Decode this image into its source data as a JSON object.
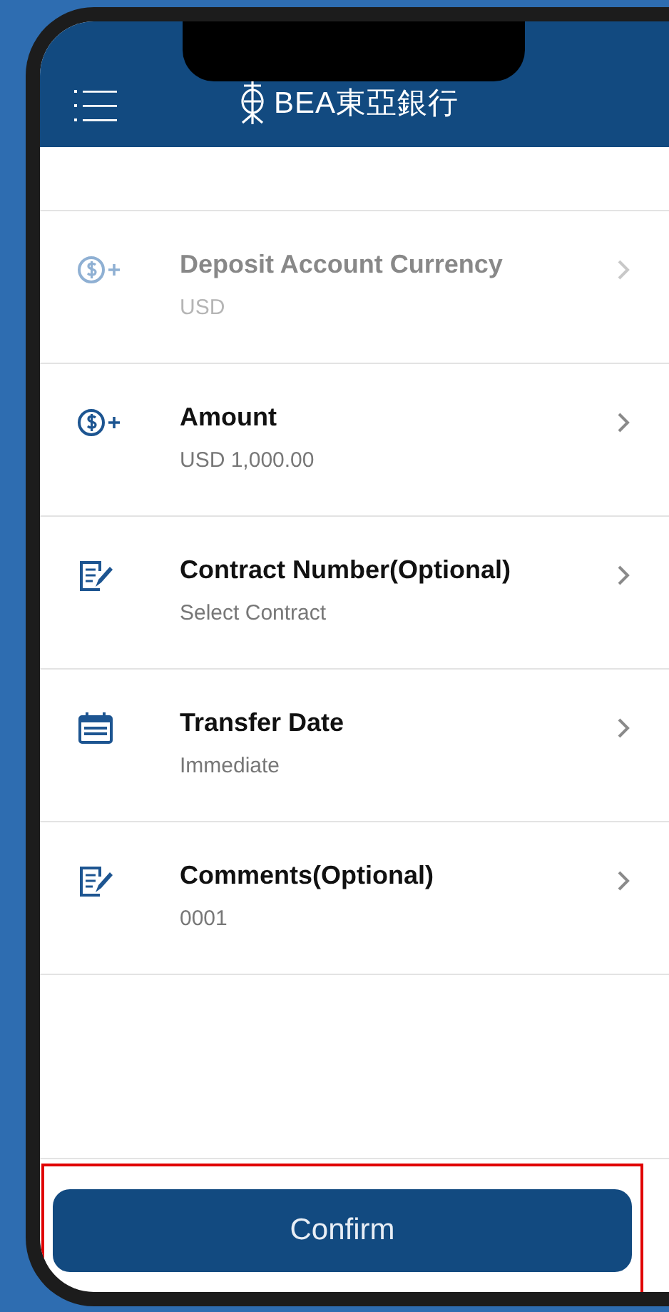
{
  "header": {
    "brand": "BEA東亞銀行"
  },
  "rows": [
    {
      "kind": "currency",
      "title": "Deposit Account Currency",
      "value": "USD",
      "disabled": true
    },
    {
      "kind": "currency",
      "title": "Amount",
      "value": "USD 1,000.00",
      "disabled": false
    },
    {
      "kind": "note",
      "title": "Contract Number(Optional)",
      "value": "Select Contract",
      "disabled": false
    },
    {
      "kind": "calendar",
      "title": "Transfer Date",
      "value": "Immediate",
      "disabled": false
    },
    {
      "kind": "note",
      "title": "Comments(Optional)",
      "value": "0001",
      "disabled": false
    }
  ],
  "confirm": {
    "label": "Confirm",
    "highlighted": true
  }
}
